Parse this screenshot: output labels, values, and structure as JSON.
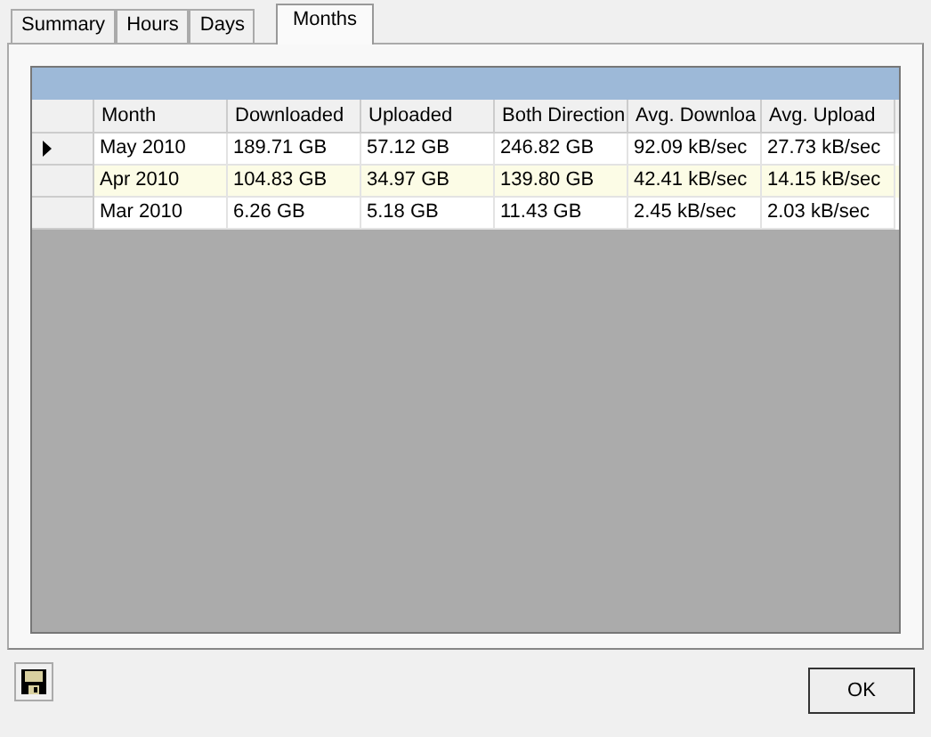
{
  "tabs": [
    {
      "label": "Summary",
      "selected": false
    },
    {
      "label": "Hours",
      "selected": false
    },
    {
      "label": "Days",
      "selected": false
    },
    {
      "label": "Months",
      "selected": true
    }
  ],
  "table": {
    "columns": [
      "Month",
      "Downloaded",
      "Uploaded",
      "Both Direction",
      "Avg. Downloa",
      "Avg. Upload"
    ],
    "rows": [
      {
        "selected": true,
        "cells": [
          "May 2010",
          "189.71 GB",
          "57.12 GB",
          "246.82 GB",
          "92.09 kB/sec",
          "27.73 kB/sec"
        ]
      },
      {
        "selected": false,
        "cells": [
          "Apr 2010",
          "104.83 GB",
          "34.97 GB",
          "139.80 GB",
          "42.41 kB/sec",
          "14.15 kB/sec"
        ]
      },
      {
        "selected": false,
        "cells": [
          "Mar 2010",
          "6.26 GB",
          "5.18 GB",
          "11.43 GB",
          "2.45 kB/sec",
          "2.03 kB/sec"
        ]
      }
    ]
  },
  "buttons": {
    "ok": "OK"
  }
}
